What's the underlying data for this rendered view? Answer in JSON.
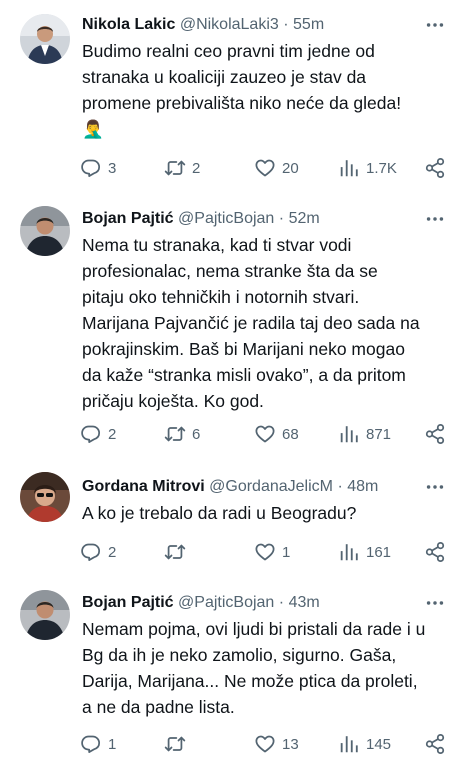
{
  "tweets": [
    {
      "name": "Nikola Lakic",
      "handle": "@NikolaLaki3",
      "sep": "·",
      "time": "55m",
      "lines": [
        "Budimo realni ceo pravni tim jedne od",
        "stranaka u koaliciji zauzeo je stav da",
        "promene prebivališta niko neće da gleda!",
        "🤦‍♂️"
      ],
      "replies": "3",
      "retweets": "2",
      "likes": "20",
      "views": "1.7K"
    },
    {
      "name": "Bojan Pajtić",
      "handle": "@PajticBojan",
      "sep": "·",
      "time": "52m",
      "lines": [
        "Nema tu stranaka, kad ti stvar vodi",
        "profesionalac, nema stranke šta da se",
        "pitaju oko tehničkih i notornih stvari.",
        "Marijana Pajvančić je radila taj deo sada na",
        "pokrajinskim. Baš bi Marijani neko mogao",
        "da kaže “stranka misli ovako”, a da pritom",
        "pričaju koješta. Ko god."
      ],
      "replies": "2",
      "retweets": "6",
      "likes": "68",
      "views": "871"
    },
    {
      "name": "Gordana Mitrovi",
      "handle": "@GordanaJelicM",
      "sep": "·",
      "time": "48m",
      "lines": [
        "A ko je trebalo da radi u Beogradu?"
      ],
      "replies": "2",
      "retweets": "",
      "likes": "1",
      "views": "161"
    },
    {
      "name": "Bojan Pajtić",
      "handle": "@PajticBojan",
      "sep": "·",
      "time": "43m",
      "lines": [
        "Nemam pojma, ovi ljudi bi pristali da rade i u",
        "Bg da ih je neko zamolio, sigurno. Gaša,",
        "Darija, Marijana... Ne može ptica da proleti,",
        "a ne da padne lista."
      ],
      "replies": "1",
      "retweets": "",
      "likes": "13",
      "views": "145"
    }
  ],
  "icons": {
    "reply": "reply-icon",
    "retweet": "retweet-icon",
    "like": "heart-icon",
    "views": "views-icon",
    "share": "share-icon",
    "more": "more-icon"
  },
  "colors": {
    "text": "#0f1419",
    "secondary": "#536471"
  }
}
